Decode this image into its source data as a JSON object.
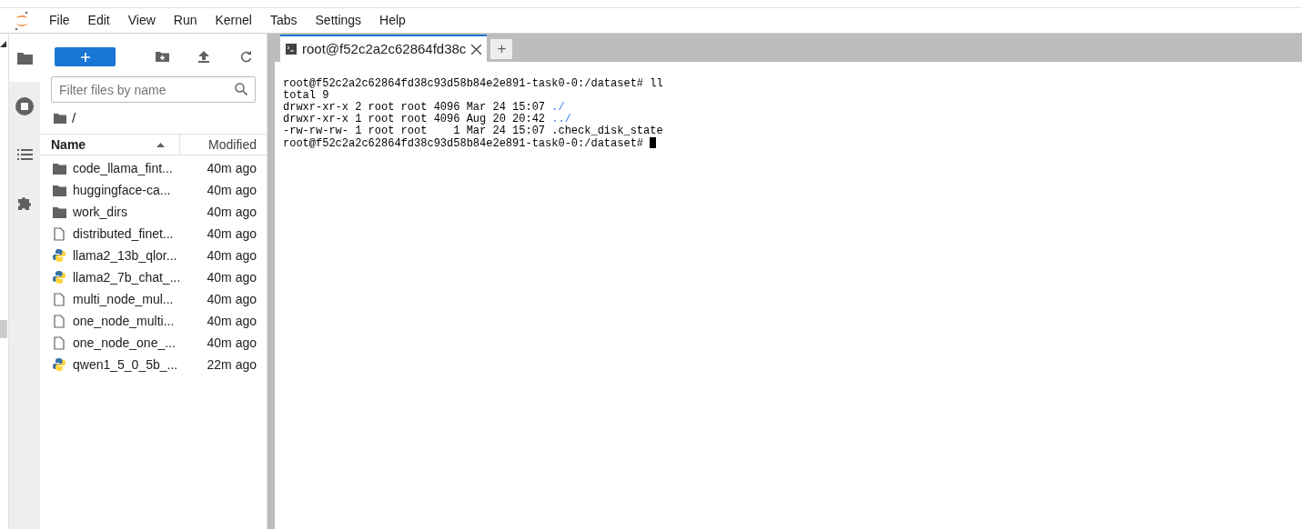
{
  "menu": [
    "File",
    "Edit",
    "View",
    "Run",
    "Kernel",
    "Tabs",
    "Settings",
    "Help"
  ],
  "sidebar_tabs": [
    {
      "kind": "folder",
      "selected": true
    },
    {
      "kind": "stop",
      "selected": false
    },
    {
      "kind": "list",
      "selected": false
    },
    {
      "kind": "puzzle",
      "selected": false
    }
  ],
  "file_browser": {
    "search": {
      "placeholder": "Filter files by name"
    },
    "path": "/",
    "columns": [
      {
        "label": "Name",
        "sorted": true
      },
      {
        "label": "Modified",
        "sorted": false
      }
    ],
    "files": [
      {
        "kind": "folder",
        "name": "code_llama_fint...",
        "modified": "40m ago",
        "selected": false
      },
      {
        "kind": "folder",
        "name": "huggingface-ca...",
        "modified": "40m ago",
        "selected": false
      },
      {
        "kind": "folder",
        "name": "work_dirs",
        "modified": "40m ago",
        "selected": false
      },
      {
        "kind": "file",
        "name": "distributed_finet...",
        "modified": "40m ago",
        "selected": false
      },
      {
        "kind": "python",
        "name": "llama2_13b_qlor...",
        "modified": "40m ago",
        "selected": false
      },
      {
        "kind": "python",
        "name": "llama2_7b_chat_...",
        "modified": "40m ago",
        "selected": false
      },
      {
        "kind": "file",
        "name": "multi_node_mul...",
        "modified": "40m ago",
        "selected": false
      },
      {
        "kind": "file",
        "name": "one_node_multi...",
        "modified": "40m ago",
        "selected": false
      },
      {
        "kind": "file",
        "name": "one_node_one_...",
        "modified": "40m ago",
        "selected": false
      },
      {
        "kind": "python",
        "name": "qwen1_5_0_5b_...",
        "modified": "22m ago",
        "selected": false
      }
    ]
  },
  "tabs": [
    {
      "label": "root@f52c2a2c62864fd38c",
      "selected": true
    }
  ],
  "new_tab": "+",
  "terminal": {
    "lines": [
      [
        {
          "kind": "plain",
          "text": "root@f52c2a2c62864fd38c93d58b84e2e891-task0-0:/dataset# ll"
        }
      ],
      [
        {
          "kind": "plain",
          "text": "total 9"
        }
      ],
      [
        {
          "kind": "plain",
          "text": "drwxr-xr-x 2 root root 4096 Mar 24 15:07 "
        },
        {
          "kind": "dir",
          "text": "./"
        }
      ],
      [
        {
          "kind": "plain",
          "text": "drwxr-xr-x 1 root root 4096 Aug 20 20:42 "
        },
        {
          "kind": "dir",
          "text": "../"
        }
      ],
      [
        {
          "kind": "plain",
          "text": "-rw-rw-rw- 1 root root    1 Mar 24 15:07 .check_disk_state"
        }
      ],
      [
        {
          "kind": "plain",
          "text": "root@f52c2a2c62864fd38c93d58b84e2e891-task0-0:/dataset# "
        }
      ]
    ],
    "cursor": true
  }
}
